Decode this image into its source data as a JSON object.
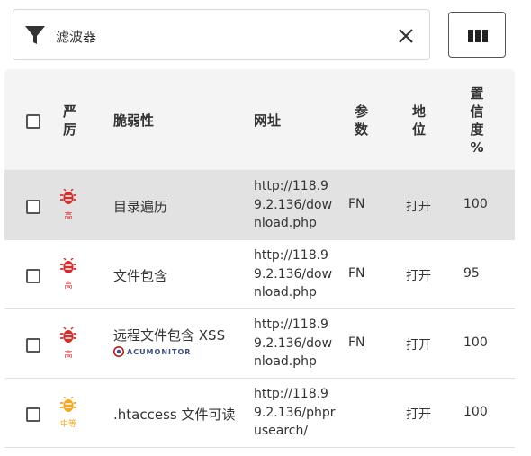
{
  "filter": {
    "label": "滤波器"
  },
  "colors": {
    "high": "#d32f2f",
    "medium": "#f5a623",
    "selected_row": "#e2e2e2",
    "header_bg": "#f4f4f4"
  },
  "table": {
    "headers": {
      "severity": [
        "严",
        "厉"
      ],
      "vulnerability": "脆弱性",
      "url": "网址",
      "params": [
        "参",
        "数"
      ],
      "status": [
        "地",
        "位"
      ],
      "confidence": [
        "置",
        "信",
        "度",
        "%"
      ]
    },
    "rows": [
      {
        "severity_label": "高",
        "severity_icon": "bug-icon",
        "vulnerability": "目录遍历",
        "url": "http://118.99.2.136/download.php",
        "params": "FN",
        "status": "打开",
        "confidence": "100"
      },
      {
        "severity_label": "高",
        "severity_icon": "bug-icon",
        "vulnerability": "文件包含",
        "url": "http://118.99.2.136/download.php",
        "params": "FN",
        "status": "打开",
        "confidence": "95"
      },
      {
        "severity_label": "高",
        "severity_icon": "bug-icon",
        "vulnerability": "远程文件包含 XSS",
        "badge": "ACUMONITOR",
        "url": "http://118.99.2.136/download.php",
        "params": "FN",
        "status": "打开",
        "confidence": "100"
      },
      {
        "severity_label": "中等",
        "severity_icon": "bug-icon",
        "vulnerability": ".htaccess 文件可读",
        "url": "http://118.99.2.136/phprusearch/",
        "params": "",
        "status": "打开",
        "confidence": "100"
      }
    ]
  }
}
